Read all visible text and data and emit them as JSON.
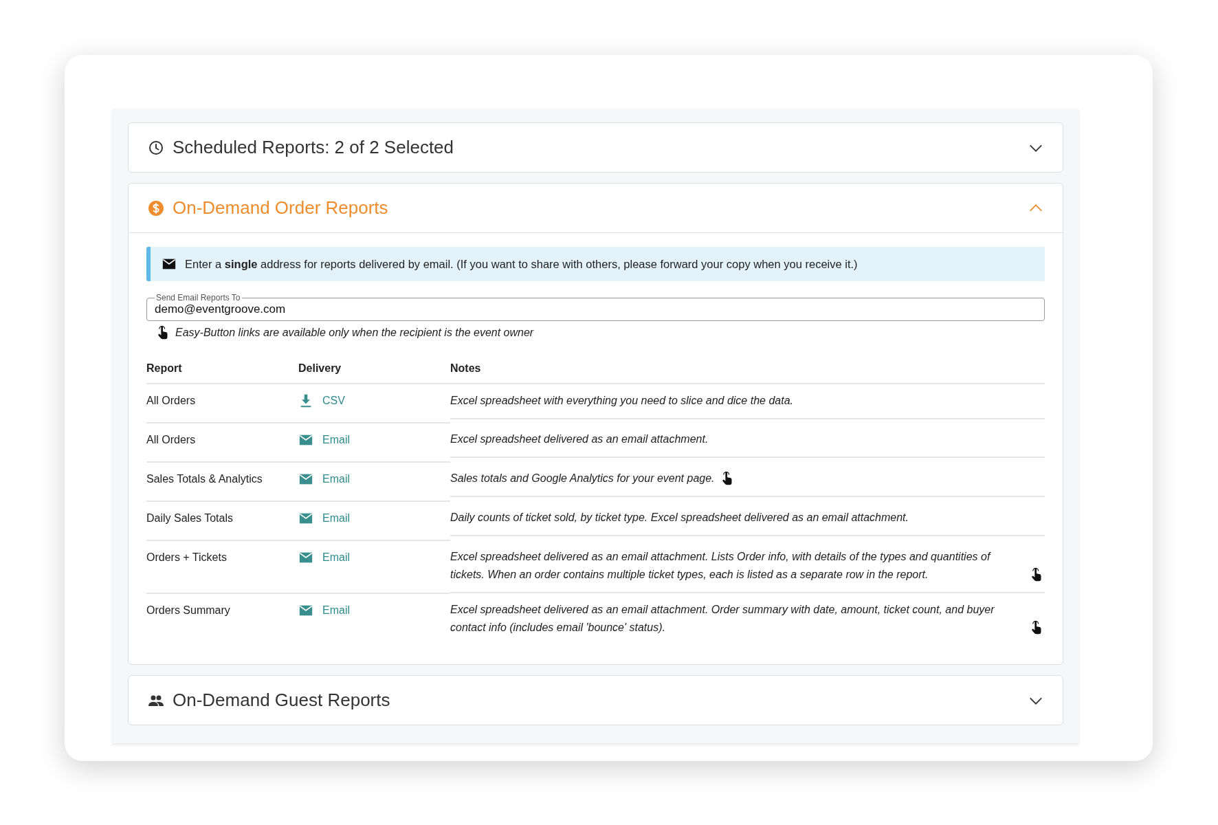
{
  "sections": [
    {
      "title": "Scheduled Reports: 2 of 2 Selected",
      "kind": "clock",
      "expanded": false
    },
    {
      "title": "On-Demand Order Reports",
      "kind": "dollar",
      "expanded": true,
      "notice": "Enter a **single** address for reports delivered by email. (If you want to share with others, please forward your copy when you receive it.)",
      "email_field": {
        "label": "Send Email Reports To",
        "value": "demo@eventgroove.com"
      },
      "hint": "Easy-Button links are available only when the recipient is the event owner",
      "table": {
        "columns": [
          "Report",
          "Delivery",
          "Notes"
        ],
        "rows": [
          {
            "report": "All Orders",
            "delivery": {
              "kind": "download",
              "label": "CSV"
            },
            "notes": "Excel spreadsheet with everything you need to slice and dice the data.",
            "easy_button": false
          },
          {
            "report": "All Orders",
            "delivery": {
              "kind": "email",
              "label": "Email"
            },
            "notes": "Excel spreadsheet delivered as an email attachment.",
            "easy_button": false
          },
          {
            "report": "Sales Totals & Analytics",
            "delivery": {
              "kind": "email",
              "label": "Email"
            },
            "notes": "Sales totals and Google Analytics for your event page.",
            "easy_button": true
          },
          {
            "report": "Daily Sales Totals",
            "delivery": {
              "kind": "email",
              "label": "Email"
            },
            "notes": "Daily counts of ticket sold, by ticket type. Excel spreadsheet delivered as an email attachment.",
            "easy_button": false
          },
          {
            "report": "Orders + Tickets",
            "delivery": {
              "kind": "email",
              "label": "Email"
            },
            "notes": "Excel spreadsheet delivered as an email attachment. Lists Order info, with details of the types and quantities of tickets. When an order contains multiple ticket types, each is listed as a separate row in the report.",
            "easy_button": true
          },
          {
            "report": "Orders Summary",
            "delivery": {
              "kind": "email",
              "label": "Email"
            },
            "notes": "Excel spreadsheet delivered as an email attachment. Order summary with date, amount, ticket count, and buyer contact info (includes email 'bounce' status).",
            "easy_button": true
          }
        ]
      }
    },
    {
      "title": "On-Demand Guest Reports",
      "kind": "people",
      "expanded": false
    }
  ]
}
